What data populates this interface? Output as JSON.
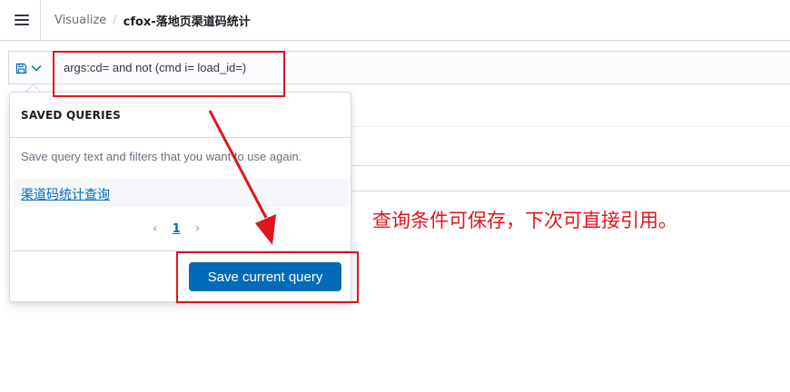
{
  "header": {
    "breadcrumb_1": "Visualize",
    "breadcrumb_sep": "/",
    "breadcrumb_2": "cfox-落地页渠道码统计"
  },
  "query_bar": {
    "query": "args:cd= and not (cmd i= load_id=)",
    "save_icon": "save-icon",
    "chevron_icon": "chevron-down-icon"
  },
  "saved_queries": {
    "title": "SAVED QUERIES",
    "description": "Save query text and filters that you want to use again.",
    "items": [
      {
        "label": "渠道码统计查询"
      }
    ],
    "pagination": {
      "prev": "‹",
      "current_page": "1",
      "next": "›"
    },
    "save_button": "Save current query"
  },
  "annotation": {
    "text": "查询条件可保存，下次可直接引用。"
  },
  "colors": {
    "accent": "#006bb8",
    "annotation_red": "#e0141e",
    "border": "#d3dae6"
  }
}
